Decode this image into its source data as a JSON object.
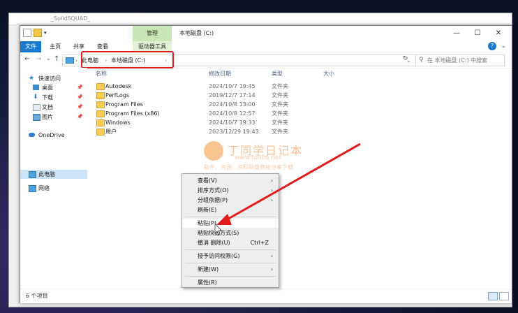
{
  "background_window": {
    "title": "_SolidSQUAD_"
  },
  "window": {
    "title": "本地磁盘 (C:)",
    "ctx_tab_group": "管理",
    "controls": {
      "minimize": "—",
      "maximize": "☐",
      "close": "✕"
    }
  },
  "ribbon": {
    "tabs": [
      "文件",
      "主页",
      "共享",
      "查看",
      "驱动器工具"
    ],
    "expand_icon": "⌄",
    "help_icon": "?"
  },
  "address": {
    "back": "←",
    "forward": "→",
    "dropdown": "⌄",
    "up": "↑",
    "crumbs": [
      "此电脑",
      "本地磁盘 (C:)"
    ],
    "separator": "›",
    "history_dropdown": "⌄",
    "refresh": "↻",
    "search_placeholder": "在 本地磁盘 (C:) 中搜索",
    "search_icon": "⚲"
  },
  "nav_pane": {
    "quick_access": "快速访问",
    "pinned": [
      "桌面",
      "下载",
      "文档",
      "图片"
    ],
    "pin_icon": "📌",
    "onedrive": "OneDrive",
    "this_pc": "此电脑",
    "network": "网络"
  },
  "columns": [
    "名称",
    "修改日期",
    "类型",
    "大小"
  ],
  "files": [
    {
      "name": "Autodesk",
      "date": "2024/10/7 19:45",
      "type": "文件夹"
    },
    {
      "name": "PerfLogs",
      "date": "2019/12/7 17:14",
      "type": "文件夹"
    },
    {
      "name": "Program Files",
      "date": "2024/10/8 13:00",
      "type": "文件夹"
    },
    {
      "name": "Program Files (x86)",
      "date": "2024/10/8 12:57",
      "type": "文件夹"
    },
    {
      "name": "Windows",
      "date": "2024/10/7 19:33",
      "type": "文件夹"
    },
    {
      "name": "用户",
      "date": "2023/12/29 19:43",
      "type": "文件夹"
    }
  ],
  "status": {
    "count": "6 个项目"
  },
  "watermark": {
    "brand": "丁同学日记本",
    "url": "www.ts006.net",
    "slogan": "软件、资源、资料网盘直接分享下载"
  },
  "context_menu": {
    "items": [
      {
        "label": "查看(V)",
        "arrow": "›"
      },
      {
        "label": "排序方式(O)",
        "arrow": "›"
      },
      {
        "label": "分组依据(P)",
        "arrow": "›"
      },
      {
        "label": "刷新(E)"
      },
      {
        "label": "粘贴(P)"
      },
      {
        "label": "粘贴快捷方式(S)"
      },
      {
        "label": "撤消 删除(U)",
        "shortcut": "Ctrl+Z"
      },
      {
        "label": "授予访问权限(G)",
        "arrow": "›"
      },
      {
        "label": "新建(W)",
        "arrow": "›"
      },
      {
        "label": "属性(R)"
      }
    ]
  },
  "colors": {
    "accent": "#1979ca",
    "highlight_box": "#e21b1b",
    "folder": "#f6cd52"
  }
}
